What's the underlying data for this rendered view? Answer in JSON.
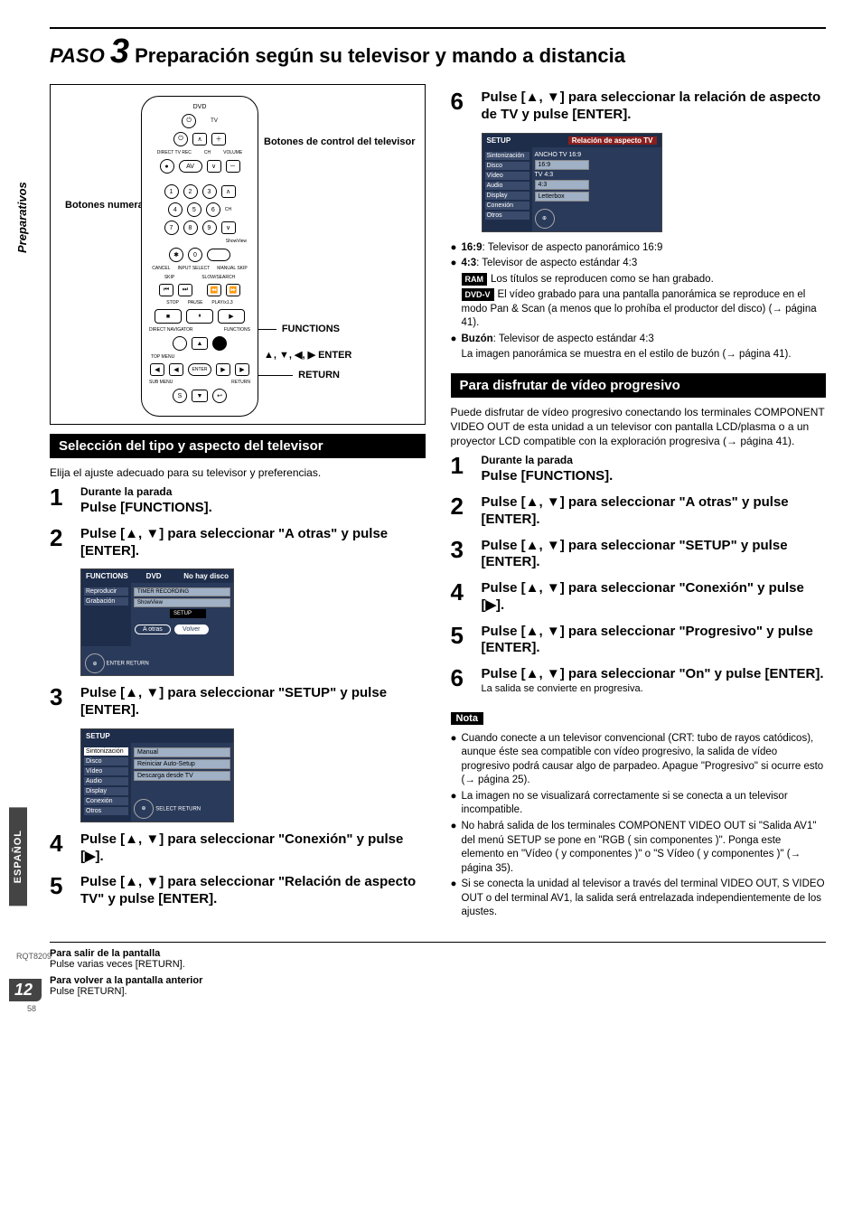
{
  "side_tab": "Preparativos",
  "lang_tab": "ESPAÑOL",
  "title": {
    "paso": "PASO",
    "num": "3",
    "rest": "Preparación según su televisor y mando a distancia"
  },
  "remote": {
    "left_label": "Botones numerados",
    "right_labels": {
      "tv": "Botones de control del televisor",
      "functions": "FUNCTIONS",
      "arrows": "▲, ▼, ◀, ▶ ENTER",
      "return": "RETURN"
    },
    "tiny": {
      "dvd": "DVD",
      "tv": "TV",
      "direct": "DIRECT TV REC",
      "av": "AV",
      "ch": "CH",
      "volume": "VOLUME",
      "showview": "ShowView",
      "cancel": "CANCEL",
      "inputsel": "INPUT SELECT",
      "manualskip": "MANUAL SKIP",
      "skip": "SKIP",
      "slow": "SLOW/SEARCH",
      "stop": "STOP",
      "pause": "PAUSE",
      "play": "PLAY/x1.3",
      "directnav": "DIRECT NAVIGATOR",
      "topmenu": "TOP MENU",
      "functions": "FUNCTIONS",
      "enter": "ENTER",
      "submenu": "SUB MENU",
      "return": "RETURN"
    }
  },
  "section1_title": "Selección del tipo y aspecto del televisor",
  "section1_intro": "Elija el ajuste adecuado para su televisor y preferencias.",
  "steps_left": {
    "s1_sub": "Durante la parada",
    "s1_main": "Pulse [FUNCTIONS].",
    "s2_main": "Pulse [▲, ▼] para seleccionar \"A otras\" y pulse [ENTER].",
    "s3_main": "Pulse [▲, ▼] para seleccionar \"SETUP\" y pulse [ENTER].",
    "s4_main": "Pulse [▲, ▼] para seleccionar \"Conexión\" y pulse [▶].",
    "s5_main": "Pulse [▲, ▼] para seleccionar \"Relación de aspecto TV\" y pulse [ENTER]."
  },
  "osd1": {
    "head_l": "FUNCTIONS",
    "head_m": "DVD",
    "head_r": "No hay disco",
    "side": [
      "Reproducir",
      "Grabación"
    ],
    "items": [
      "TIMER RECORDING",
      "ShowView"
    ],
    "setup": "SETUP",
    "pills": [
      "A otras",
      "Volver"
    ],
    "hint": "ENTER RETURN"
  },
  "osd2": {
    "head": "SETUP",
    "side": [
      "Sintonización",
      "Disco",
      "Vídeo",
      "Audio",
      "Display",
      "Conexión",
      "Otros"
    ],
    "items": [
      "Manual",
      "Reiniciar Auto-Setup",
      "Descarga desde TV"
    ],
    "foot": "SELECT  RETURN"
  },
  "step6_main": "Pulse [▲, ▼] para seleccionar la relación de aspecto de TV y pulse [ENTER].",
  "osd3": {
    "head": "SETUP",
    "side": [
      "Sintonización",
      "Disco",
      "Vídeo",
      "Audio",
      "Display",
      "Conexión",
      "Otros"
    ],
    "rhead": "Relación de aspecto TV",
    "g1_label": "ANCHO TV 16:9",
    "g1_opt": "16:9",
    "g2_label": "TV 4:3",
    "g2_opt": "4:3",
    "g3_opt": "Letterbox"
  },
  "aspect_bullets": {
    "b1": "16:9",
    "b1_t": ": Televisor de aspecto panorámico 16:9",
    "b2": "4:3",
    "b2_t": ": Televisor de aspecto estándar 4:3",
    "ram_t": "Los títulos se reproducen como se han grabado.",
    "dvdv_t": "El vídeo grabado para una pantalla panorámica se reproduce en el modo Pan & Scan (a menos que lo prohíba el productor del disco) (→ página 41).",
    "b3": "Buzón",
    "b3_t": ": Televisor de aspecto estándar 4:3",
    "b3_sub": "La imagen panorámica se muestra en el estilo de buzón (→ página 41)."
  },
  "section2_title": "Para disfrutar de vídeo progresivo",
  "section2_intro": "Puede disfrutar de vídeo progresivo conectando los terminales COMPONENT VIDEO OUT de esta unidad a un televisor con pantalla LCD/plasma o a un proyector LCD compatible con la exploración progresiva (→ página 41).",
  "steps_right": {
    "s1_sub": "Durante la parada",
    "s1_main": "Pulse [FUNCTIONS].",
    "s2_main": "Pulse [▲, ▼] para seleccionar \"A otras\" y pulse [ENTER].",
    "s3_main": "Pulse [▲, ▼] para seleccionar \"SETUP\" y pulse [ENTER].",
    "s4_main": "Pulse [▲, ▼] para seleccionar \"Conexión\" y pulse [▶].",
    "s5_main": "Pulse [▲, ▼] para seleccionar \"Progresivo\" y pulse [ENTER].",
    "s6_main": "Pulse [▲, ▼] para seleccionar \"On\" y pulse [ENTER].",
    "s6_note": "La salida se convierte en progresiva."
  },
  "nota_label": "Nota",
  "notas": [
    "Cuando conecte a un televisor convencional (CRT: tubo de rayos catódicos), aunque éste sea compatible con vídeo progresivo, la salida de vídeo progresivo podrá causar algo de parpadeo. Apague \"Progresivo\" si ocurre esto (→ página 25).",
    "La imagen no se visualizará correctamente si se conecta a un televisor incompatible.",
    "No habrá salida de los terminales COMPONENT VIDEO OUT si \"Salida AV1\" del menú SETUP se pone en \"RGB ( sin componentes )\". Ponga este elemento en \"Vídeo ( y componentes )\" o \"S Vídeo ( y componentes )\" (→ página 35).",
    "Si se conecta la unidad al televisor a través del terminal VIDEO OUT, S VIDEO OUT o del terminal AV1, la salida será entrelazada independientemente de los ajustes."
  ],
  "footer": {
    "exit_h": "Para salir de la pantalla",
    "exit_t": "Pulse varias veces [RETURN].",
    "back_h": "Para volver a la pantalla anterior",
    "back_t": "Pulse [RETURN]."
  },
  "rqt": "RQT8209",
  "pagenum": "12",
  "subpage": "58",
  "badges": {
    "ram": "RAM",
    "dvdv": "DVD-V"
  }
}
